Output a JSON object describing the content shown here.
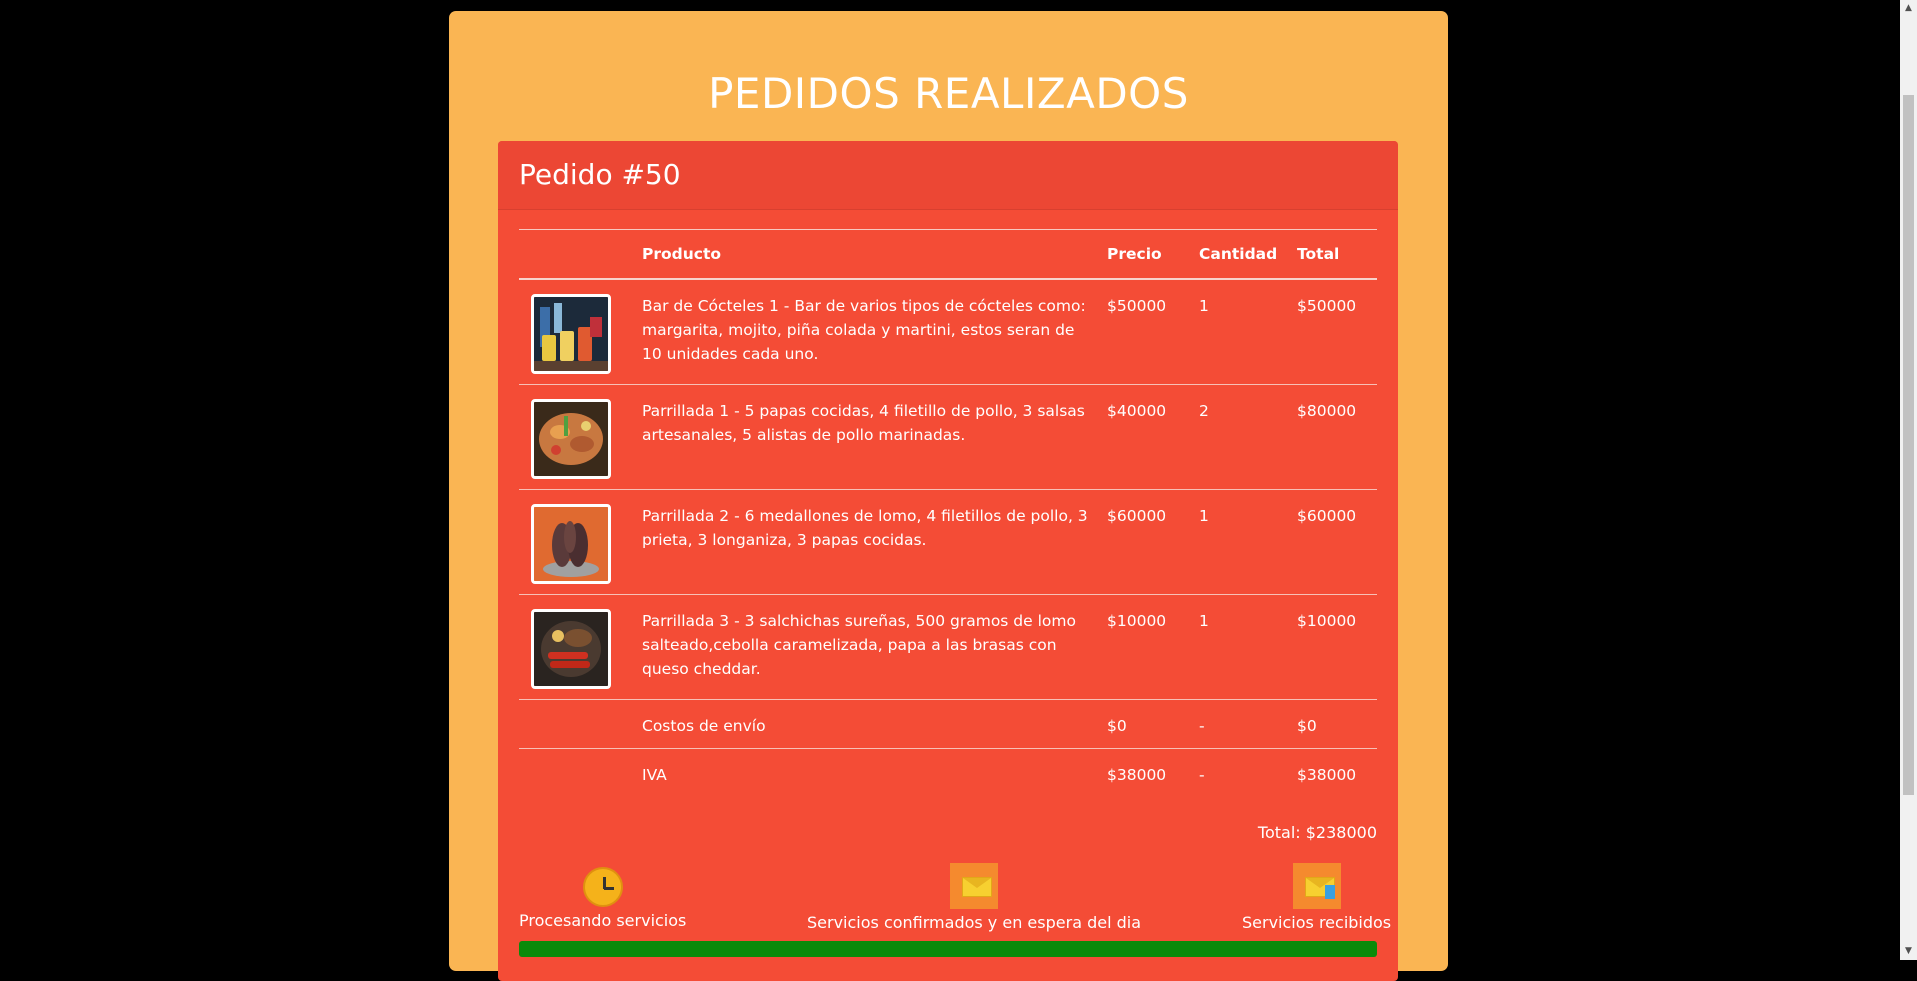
{
  "page": {
    "title": "PEDIDOS REALIZADOS"
  },
  "order": {
    "title": "Pedido #50",
    "columns": {
      "image": "",
      "product": "Producto",
      "price": "Precio",
      "qty": "Cantidad",
      "total": "Total"
    },
    "items": [
      {
        "image_icon": "cocktail-bar-photo",
        "product": "Bar de Cócteles 1 - Bar de varios tipos de cócteles como: margarita, mojito, piña colada y martini, estos seran de 10 unidades cada uno.",
        "price": "$50000",
        "qty": "1",
        "total": "$50000"
      },
      {
        "image_icon": "grill-platter-photo",
        "product": "Parrillada 1 - 5 papas cocidas, 4 filetillo de pollo, 3 salsas artesanales, 5 alistas de pollo marinadas.",
        "price": "$40000",
        "qty": "2",
        "total": "$80000"
      },
      {
        "image_icon": "grilled-meat-photo",
        "product": "Parrillada 2 - 6 medallones de lomo, 4 filetillos de pollo, 3 prieta, 3 longaniza, 3 papas cocidas.",
        "price": "$60000",
        "qty": "1",
        "total": "$60000"
      },
      {
        "image_icon": "sausage-grill-photo",
        "product": "Parrillada 3 - 3 salchichas sureñas, 500 gramos de lomo salteado,cebolla caramelizada, papa a las brasas con queso cheddar.",
        "price": "$10000",
        "qty": "1",
        "total": "$10000"
      }
    ],
    "shipping": {
      "label": "Costos de envío",
      "price": "$0",
      "qty": "-",
      "total": "$0"
    },
    "tax": {
      "label": "IVA",
      "price": "$38000",
      "qty": "-",
      "total": "$38000"
    },
    "grand_total": "Total: $238000",
    "status_steps": [
      {
        "icon": "clock-icon",
        "label": "Procesando servicios"
      },
      {
        "icon": "mail-icon",
        "label": "Servicios confirmados y en espera del dia"
      },
      {
        "icon": "mail-received-icon",
        "label": "Servicios recibidos"
      }
    ],
    "progress_fraction": 1.0,
    "colors": {
      "outer": "#fab553",
      "card": "#f44c36",
      "header": "#ec4734",
      "progress": "#0a8a0a"
    }
  }
}
